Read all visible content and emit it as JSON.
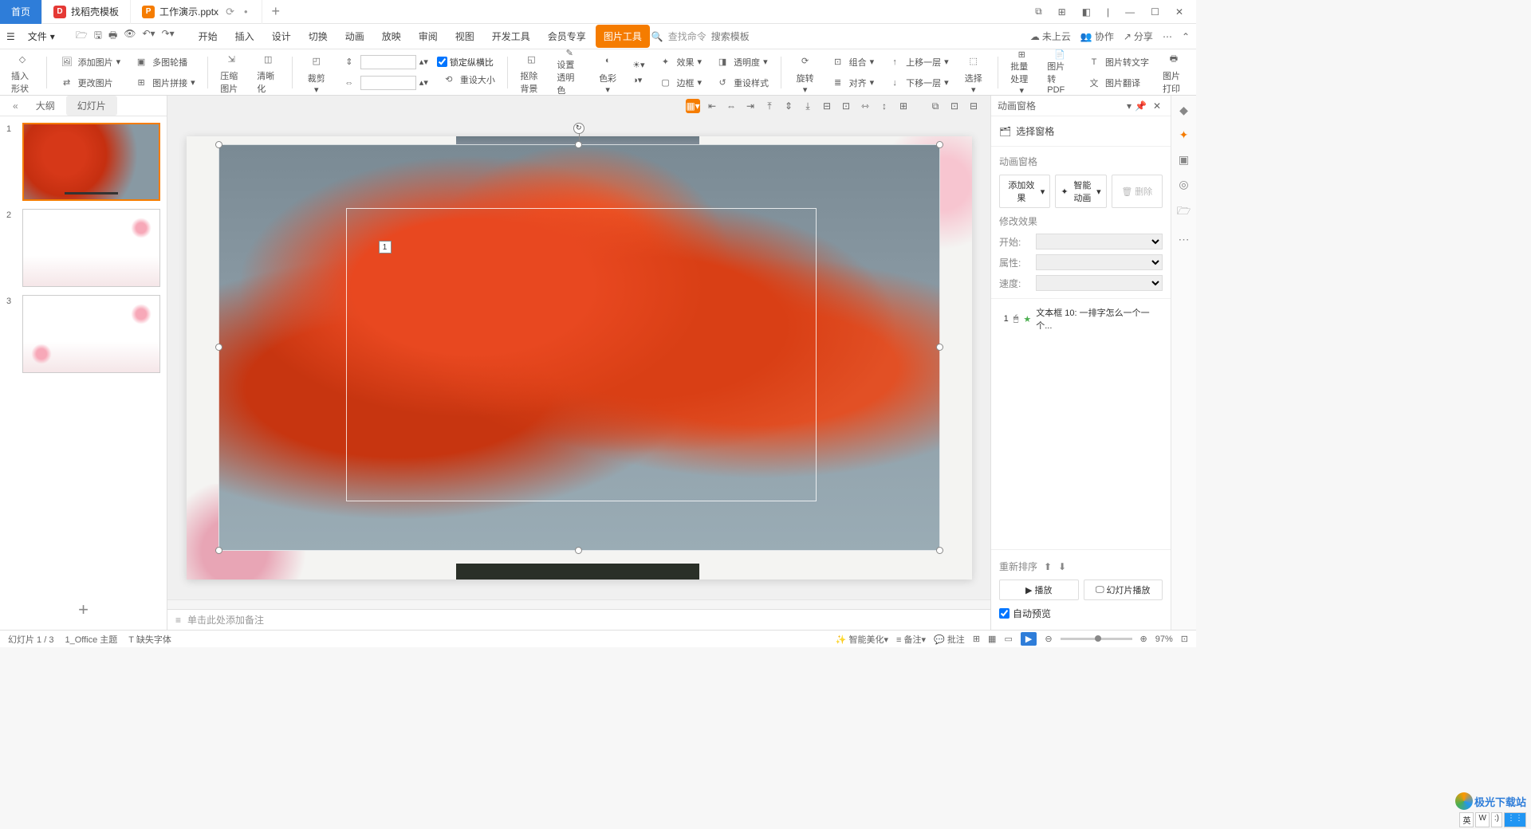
{
  "titlebar": {
    "home": "首页",
    "tab1": "找稻壳模板",
    "tab2": "工作演示.pptx",
    "restore_hint": "⟳",
    "add": "+"
  },
  "menu": {
    "file": "文件",
    "tabs": [
      "开始",
      "插入",
      "设计",
      "切换",
      "动画",
      "放映",
      "审阅",
      "视图",
      "开发工具",
      "会员专享"
    ],
    "context_tab": "图片工具",
    "search_label": "查找命令",
    "search_placeholder": "搜索模板",
    "cloud": "未上云",
    "coop": "协作",
    "share": "分享"
  },
  "ribbon": {
    "insert_shape": "插入形状",
    "add_image": "添加图片",
    "multi_outline": "多图轮播",
    "change_image": "更改图片",
    "image_puzzle": "图片拼接",
    "compress": "压缩图片",
    "sharpen": "清晰化",
    "crop": "裁剪",
    "lock_ratio": "锁定纵横比",
    "reset_size": "重设大小",
    "remove_bg": "抠除背景",
    "set_transparent": "设置透明色",
    "color": "色彩",
    "effect": "效果",
    "transparency": "透明度",
    "border": "边框",
    "reset_style": "重设样式",
    "rotate": "旋转",
    "combine": "组合",
    "align": "对齐",
    "move_up": "上移一层",
    "move_down": "下移一层",
    "select": "选择",
    "batch": "批量处理",
    "to_pdf": "图片转PDF",
    "to_text": "图片转文字",
    "translate": "图片翻译",
    "print": "图片打印"
  },
  "slidepanel": {
    "tab_outline": "大纲",
    "tab_slides": "幻灯片",
    "slides": [
      1,
      2,
      3
    ]
  },
  "canvas": {
    "tag": "1"
  },
  "notes": {
    "placeholder": "单击此处添加备注"
  },
  "anim_pane": {
    "title": "动画窗格",
    "select_pane": "选择窗格",
    "anim_pane_label": "动画窗格",
    "add_effect": "添加效果",
    "smart_anim": "智能动画",
    "delete": "删除",
    "modify_label": "修改效果",
    "start_label": "开始:",
    "attr_label": "属性:",
    "speed_label": "速度:",
    "item1_num": "1",
    "item1_text": "文本框 10: 一排字怎么一个一个...",
    "reorder": "重新排序",
    "play": "播放",
    "slideshow": "幻灯片播放",
    "auto_preview": "自动预览"
  },
  "status": {
    "slide_info": "幻灯片 1 / 3",
    "theme": "1_Office 主题",
    "missing_font": "缺失字体",
    "beautify": "智能美化",
    "notes": "备注",
    "comments": "批注",
    "zoom": "97%"
  },
  "watermark": "极光下载站",
  "ime": [
    "英",
    "W",
    ":)"
  ]
}
